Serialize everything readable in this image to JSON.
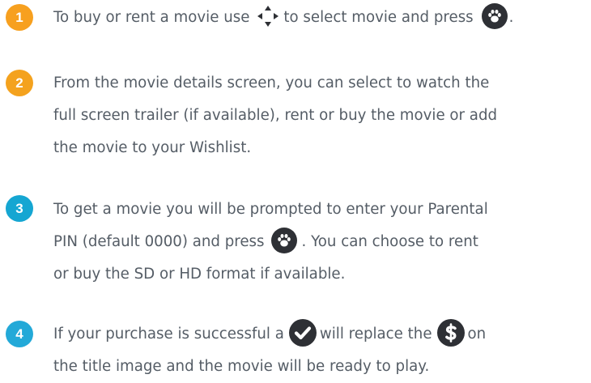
{
  "colors": {
    "badge_1": "#f7a01f",
    "badge_2": "#f4a21e",
    "badge_3": "#15a6d2",
    "badge_4": "#23a9d8",
    "text": "#555d66",
    "icon_dark": "#2e3035"
  },
  "steps": [
    {
      "number": "1",
      "lines": [
        "To buy or rent a movie use",
        "to select movie and press",
        "."
      ]
    },
    {
      "number": "2",
      "lines": [
        "From the movie details screen, you can select to watch the",
        "full screen trailer (if available), rent or buy the movie or add",
        "the movie to your Wishlist."
      ]
    },
    {
      "number": "3",
      "lines": [
        "To get a movie you will be prompted to enter your Parental",
        "PIN (default 0000) and press",
        ". You can choose to rent",
        "or buy the SD or HD format if available."
      ]
    },
    {
      "number": "4",
      "lines": [
        "If your purchase is successful a",
        "will replace the",
        "on",
        "the title image and the movie will be ready to play."
      ]
    }
  ],
  "icons": {
    "dpad": "arrow-keys-icon",
    "ok": "paw-ok-button-icon",
    "purchased": "checkmark-icon",
    "price": "dollar-icon"
  }
}
